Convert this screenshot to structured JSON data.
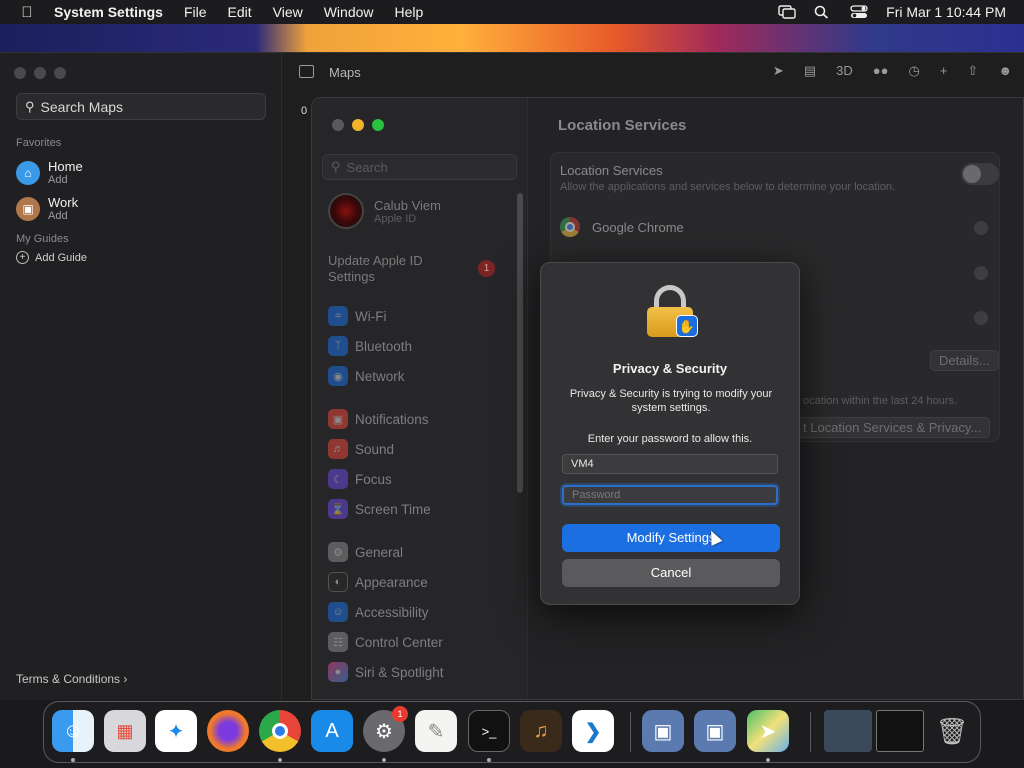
{
  "menubar": {
    "app_name": "System Settings",
    "menus": [
      "File",
      "Edit",
      "View",
      "Window",
      "Help"
    ],
    "clock": "Fri Mar 1  10:44 PM"
  },
  "maps": {
    "title": "Maps",
    "search_placeholder": "Search Maps",
    "favorites_label": "Favorites",
    "favorites": [
      {
        "name": "Home",
        "sub": "Add"
      },
      {
        "name": "Work",
        "sub": "Add"
      }
    ],
    "guides_label": "My Guides",
    "add_guide": "Add Guide",
    "terms": "Terms & Conditions",
    "toolbar_3d": "3D",
    "map_fragment": "0"
  },
  "settings": {
    "search_placeholder": "Search",
    "account_name": "Calub Viem",
    "account_sub": "Apple ID",
    "update_text": "Update Apple ID Settings",
    "update_badge": "1",
    "sidebar_items": [
      {
        "label": "Wi-Fi",
        "color": "#1a6ee0",
        "icon": "wifi-icon"
      },
      {
        "label": "Bluetooth",
        "color": "#1a6ee0",
        "icon": "bluetooth-icon"
      },
      {
        "label": "Network",
        "color": "#1a6ee0",
        "icon": "globe-icon"
      },
      {
        "label": "Notifications",
        "color": "#e8453a",
        "icon": "bell-icon"
      },
      {
        "label": "Sound",
        "color": "#e8453a",
        "icon": "speaker-icon"
      },
      {
        "label": "Focus",
        "color": "#6a4ae0",
        "icon": "moon-icon"
      },
      {
        "label": "Screen Time",
        "color": "#6a4ae0",
        "icon": "hourglass-icon"
      },
      {
        "label": "General",
        "color": "#8a8a8c",
        "icon": "gear-icon"
      },
      {
        "label": "Appearance",
        "color": "#2a2a2a",
        "icon": "appearance-icon"
      },
      {
        "label": "Accessibility",
        "color": "#1a6ee0",
        "icon": "accessibility-icon"
      },
      {
        "label": "Control Center",
        "color": "#8a8a8c",
        "icon": "control-center-icon"
      },
      {
        "label": "Siri & Spotlight",
        "color": "#c04ae0",
        "icon": "siri-icon"
      }
    ],
    "page_title": "Location Services",
    "location_label": "Location Services",
    "location_desc": "Allow the applications and services below to determine your location.",
    "app_chrome": "Google Chrome",
    "details_button": "Details...",
    "hint_text": "ocation within the last 24 hours.",
    "system_services_button": "t Location Services & Privacy..."
  },
  "dialog": {
    "title": "Privacy & Security",
    "message": "Privacy & Security is trying to modify your system settings.",
    "prompt": "Enter your password to allow this.",
    "username": "VM4",
    "password_placeholder": "Password",
    "primary_button": "Modify Settings",
    "cancel_button": "Cancel"
  },
  "dock": {
    "settings_badge": "1"
  }
}
